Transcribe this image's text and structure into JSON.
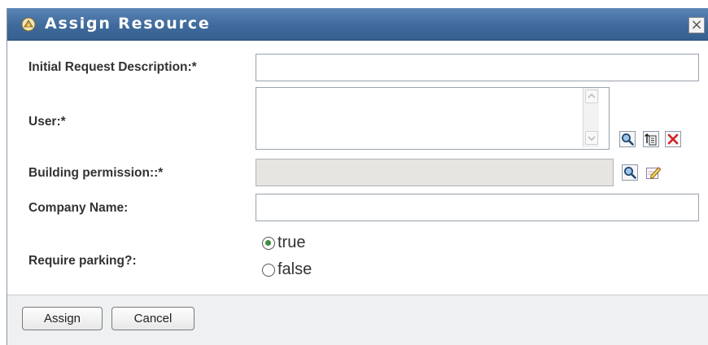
{
  "dialog": {
    "title": "Assign Resource",
    "close_label": "×"
  },
  "form": {
    "initial_request_description": {
      "label": "Initial Request Description:*",
      "value": ""
    },
    "user": {
      "label": "User:*",
      "value": ""
    },
    "building_permission": {
      "label": "Building permission::*",
      "value": ""
    },
    "company_name": {
      "label": "Company Name:",
      "value": ""
    },
    "require_parking": {
      "label": "Require parking?:",
      "options": [
        {
          "label": "true",
          "selected": true
        },
        {
          "label": "false",
          "selected": false
        }
      ]
    }
  },
  "icons": {
    "user_actions": [
      "search-icon",
      "history-icon",
      "clear-icon"
    ],
    "building_actions": [
      "search-icon",
      "edit-icon"
    ]
  },
  "colors": {
    "title_bar": "#3f6a9c",
    "title_text": "#ffffff",
    "clear_red": "#d42020"
  },
  "footer": {
    "assign_label": "Assign",
    "cancel_label": "Cancel"
  }
}
